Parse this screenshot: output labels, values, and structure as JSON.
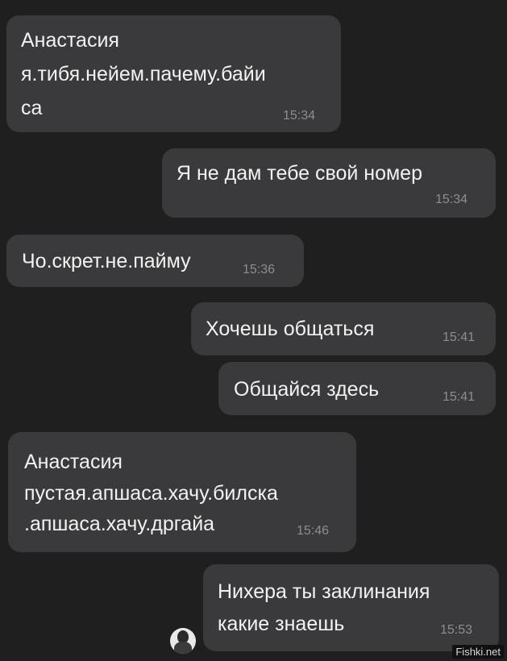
{
  "messages": [
    {
      "sender": "Анастасия",
      "lines": [
        "я.тибя.нейем.пачему.байи",
        "са"
      ],
      "time": "15:34"
    },
    {
      "lines": [
        "Я не дам тебе свой номер"
      ],
      "time": "15:34"
    },
    {
      "lines": [
        "Чо.скрет.не.пайму"
      ],
      "time": "15:36"
    },
    {
      "lines": [
        "Хочешь общаться"
      ],
      "time": "15:41"
    },
    {
      "lines": [
        "Общайся здесь"
      ],
      "time": "15:41"
    },
    {
      "sender": "Анастасия",
      "lines": [
        "пустая.апшаса.хачу.билска",
        ".апшаса.хачу.дргайа"
      ],
      "time": "15:46"
    },
    {
      "lines": [
        "Нихера ты заклинания",
        "какие знаешь"
      ],
      "time": "15:53"
    }
  ],
  "watermark": "Fishki.net"
}
